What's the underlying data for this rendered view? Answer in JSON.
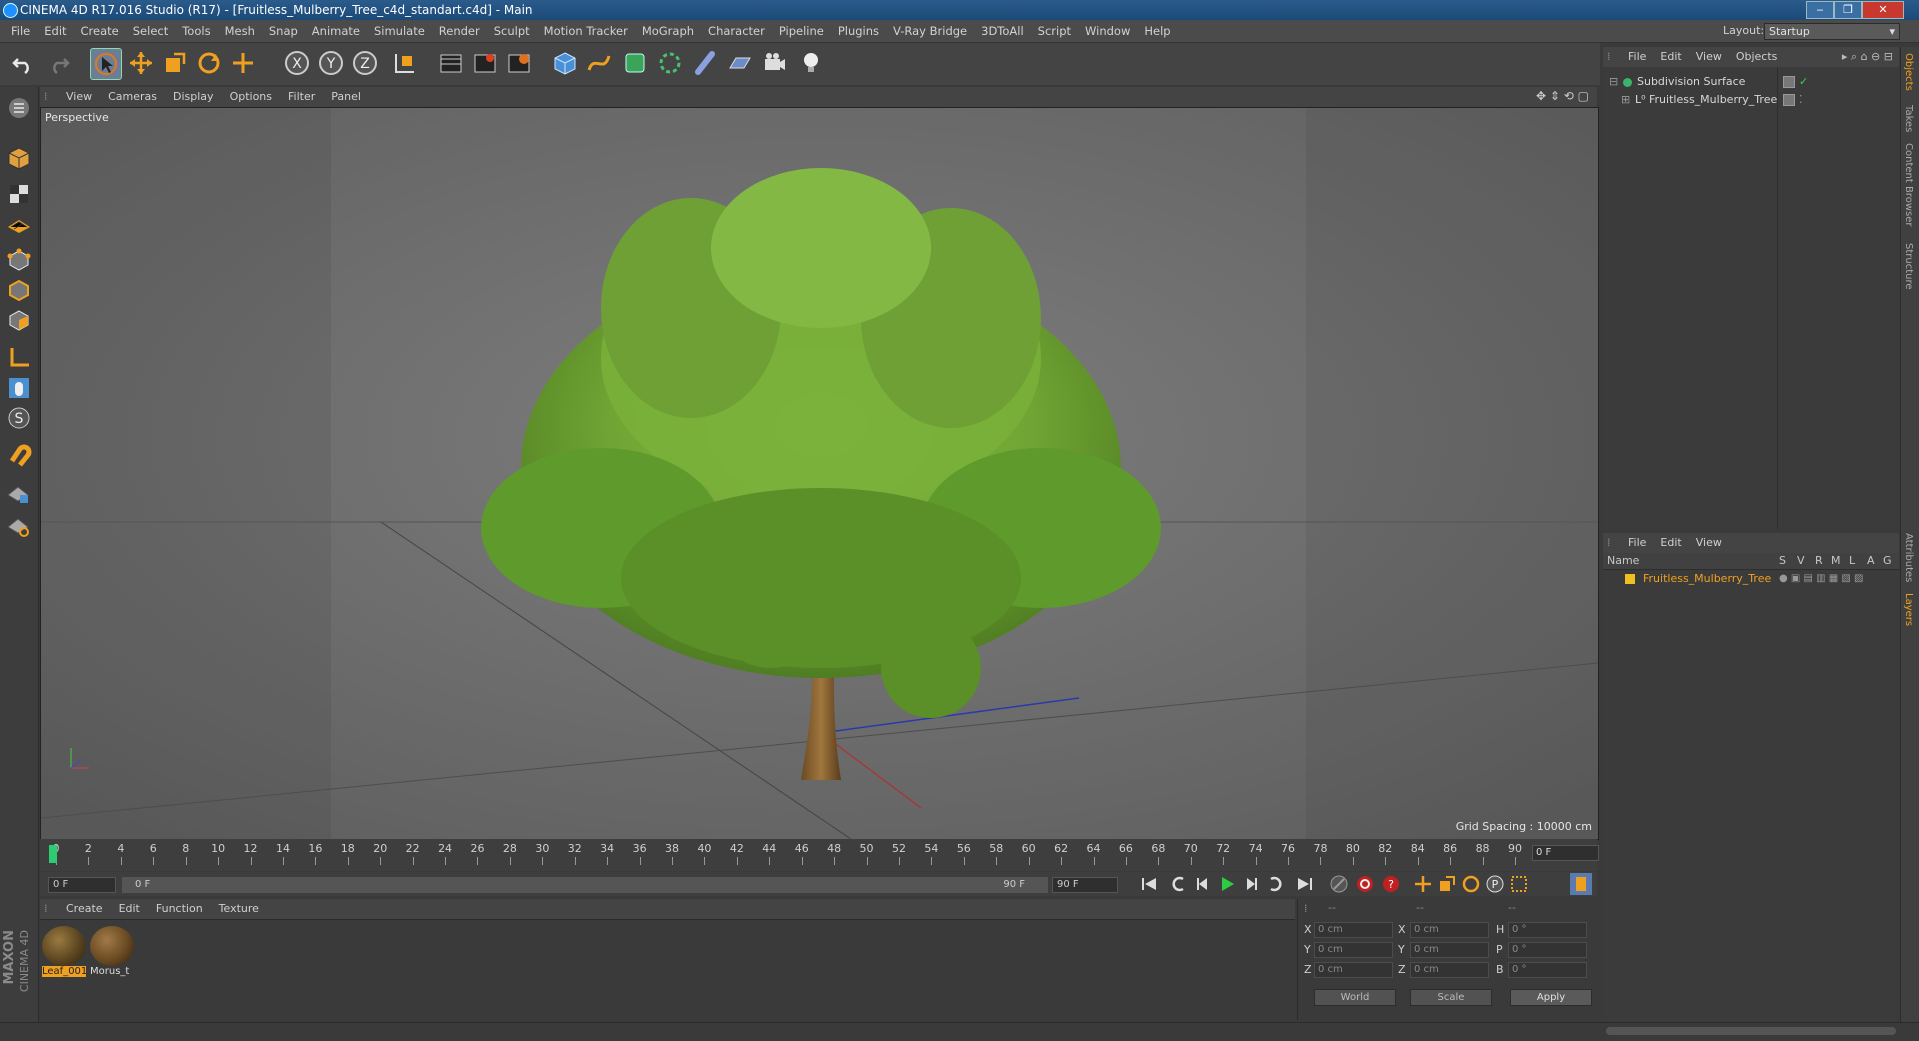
{
  "window": {
    "title": "CINEMA 4D R17.016 Studio (R17) - [Fruitless_Mulberry_Tree_c4d_standart.c4d] - Main",
    "minimize": "‒",
    "maximize": "❐",
    "close": "✕"
  },
  "menubar": {
    "items": [
      "File",
      "Edit",
      "Create",
      "Select",
      "Tools",
      "Mesh",
      "Snap",
      "Animate",
      "Simulate",
      "Render",
      "Sculpt",
      "Motion Tracker",
      "MoGraph",
      "Character",
      "Pipeline",
      "Plugins",
      "V-Ray Bridge",
      "3DToAll",
      "Script",
      "Window",
      "Help"
    ],
    "layout_label": "Layout:",
    "layout_value": "Startup"
  },
  "toolbar": {
    "icons": [
      "undo-icon",
      "redo-icon",
      "select-arrow-icon",
      "move-icon",
      "scale-icon",
      "rotate-icon",
      "live-select-icon",
      "x-axis-icon",
      "y-axis-icon",
      "z-axis-icon",
      "coordinate-system-icon",
      "render-view-icon",
      "render-picture-viewer-icon",
      "render-settings-icon",
      "cube-icon",
      "pen-spline-icon",
      "subdivision-icon",
      "array-icon",
      "deformer-icon",
      "floor-icon",
      "camera-icon",
      "light-icon"
    ],
    "axis_x": "X",
    "axis_y": "Y",
    "axis_z": "Z"
  },
  "left_toolbar": {
    "icons": [
      "make-editable-icon",
      "model-mode-icon",
      "texture-mode-icon",
      "workplane-icon",
      "points-mode-icon",
      "edges-mode-icon",
      "polygons-mode-icon",
      "axis-mode-icon",
      "tweak-icon",
      "snap-icon",
      "magnet-icon",
      "locked-workplane-icon",
      "planar-workplane-icon"
    ],
    "snap_letter": "S"
  },
  "viewport": {
    "menu": [
      "View",
      "Cameras",
      "Display",
      "Options",
      "Filter",
      "Panel"
    ],
    "camera_label": "Perspective",
    "grid_spacing": "Grid Spacing : 10000 cm"
  },
  "timeline": {
    "ticks": [
      "0",
      "2",
      "4",
      "6",
      "8",
      "10",
      "12",
      "14",
      "16",
      "18",
      "20",
      "22",
      "24",
      "26",
      "28",
      "30",
      "32",
      "34",
      "36",
      "38",
      "40",
      "42",
      "44",
      "46",
      "48",
      "50",
      "52",
      "54",
      "56",
      "58",
      "60",
      "62",
      "64",
      "66",
      "68",
      "70",
      "72",
      "74",
      "76",
      "78",
      "80",
      "82",
      "84",
      "86",
      "88",
      "90"
    ],
    "current_frame_box": "0 F"
  },
  "transport": {
    "start_frame": "0 F",
    "range_start": "0 F",
    "range_end": "90 F",
    "end_frame": "90 F"
  },
  "materials": {
    "menu": [
      "Create",
      "Edit",
      "Function",
      "Texture"
    ],
    "items": [
      {
        "label": "Leaf_001",
        "active": true
      },
      {
        "label": "Morus_t",
        "active": false
      }
    ]
  },
  "coordinates": {
    "headers": [
      "--",
      "--",
      "--"
    ],
    "rows": [
      {
        "axis": "X",
        "pos": "0 cm",
        "axis2": "X",
        "size": "0 cm",
        "rot_label": "H",
        "rot": "0 °"
      },
      {
        "axis": "Y",
        "pos": "0 cm",
        "axis2": "Y",
        "size": "0 cm",
        "rot_label": "P",
        "rot": "0 °"
      },
      {
        "axis": "Z",
        "pos": "0 cm",
        "axis2": "Z",
        "size": "0 cm",
        "rot_label": "B",
        "rot": "0 °"
      }
    ],
    "world_select": "World",
    "scale_select": "Scale",
    "apply": "Apply"
  },
  "objects_panel": {
    "menu": [
      "File",
      "Edit",
      "View",
      "Objects"
    ],
    "items": [
      {
        "name": "Subdivision Surface",
        "check": "✓"
      },
      {
        "name": "Fruitless_Mulberry_Tree",
        "check": "⁚"
      }
    ]
  },
  "layers_panel": {
    "menu": [
      "File",
      "Edit",
      "View"
    ],
    "header": "Name",
    "columns": [
      "S",
      "V",
      "R",
      "M",
      "L",
      "A",
      "G"
    ],
    "items": [
      {
        "name": "Fruitless_Mulberry_Tree"
      }
    ]
  },
  "side_tabs": [
    "Objects",
    "Takes",
    "Content Browser",
    "Structure",
    "Attributes",
    "Layers"
  ],
  "branding": {
    "line1": "MAXON",
    "line2": "CINEMA 4D"
  }
}
